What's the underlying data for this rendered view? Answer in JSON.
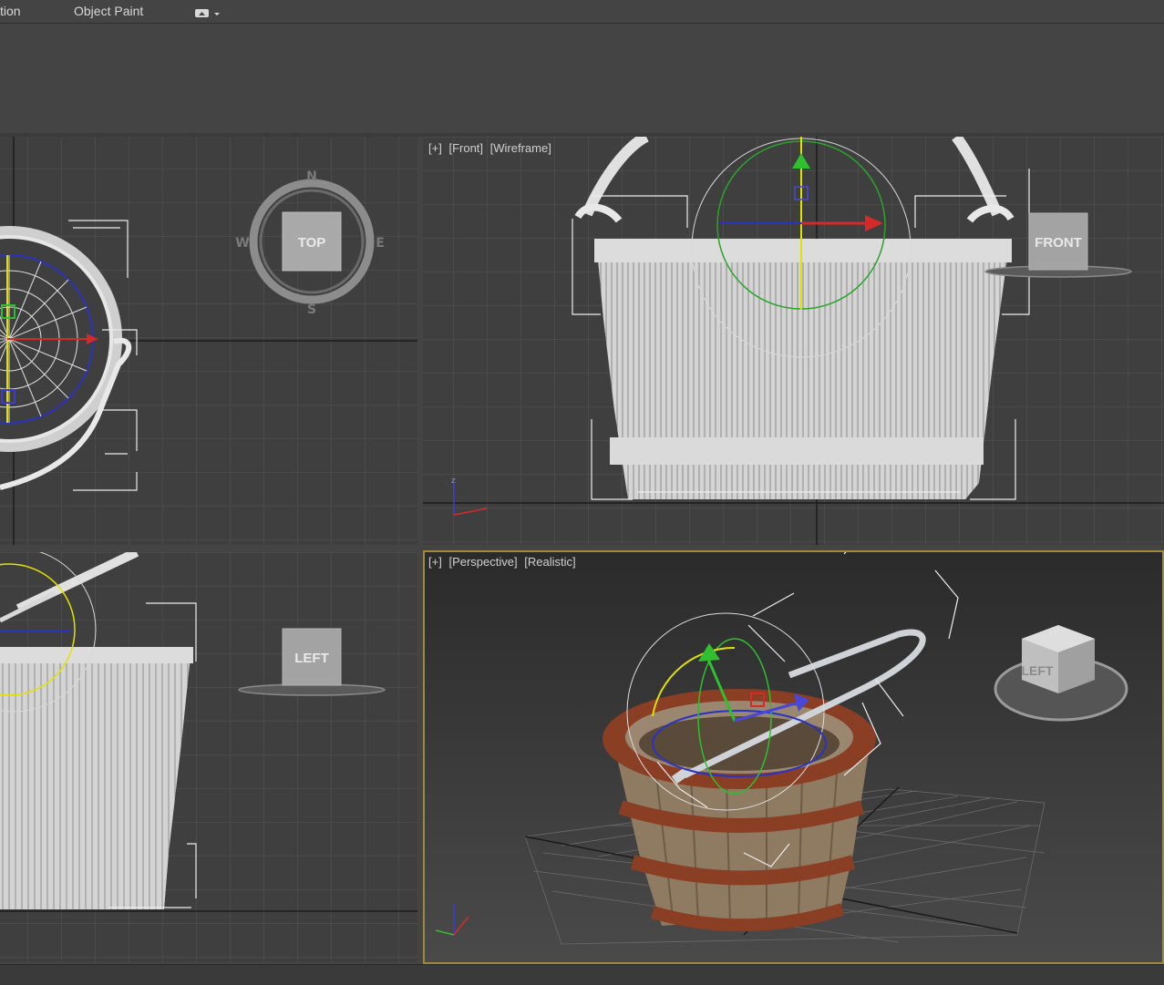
{
  "menubar": {
    "item_partial": "tion",
    "item_object_paint": "Object Paint"
  },
  "viewports": {
    "front": {
      "plus": "[+]",
      "view": "[Front]",
      "shading": "[Wireframe]",
      "cube": "FRONT"
    },
    "top": {
      "cube": "TOP",
      "compass": {
        "n": "N",
        "s": "S",
        "e": "E",
        "w": "W"
      }
    },
    "left": {
      "cube": "LEFT"
    },
    "perspective": {
      "plus": "[+]",
      "view": "[Perspective]",
      "shading": "[Realistic]",
      "cube": "LEFT"
    }
  },
  "colors": {
    "viewport_bg": "#3f3f3f",
    "grid": "#565656",
    "active_border": "#a08a3a",
    "mesh": "#d7d7d7",
    "wood": "#8f7a62",
    "rust": "#8a3e24"
  },
  "icons": [
    "chevron-down-icon",
    "window-icon"
  ]
}
